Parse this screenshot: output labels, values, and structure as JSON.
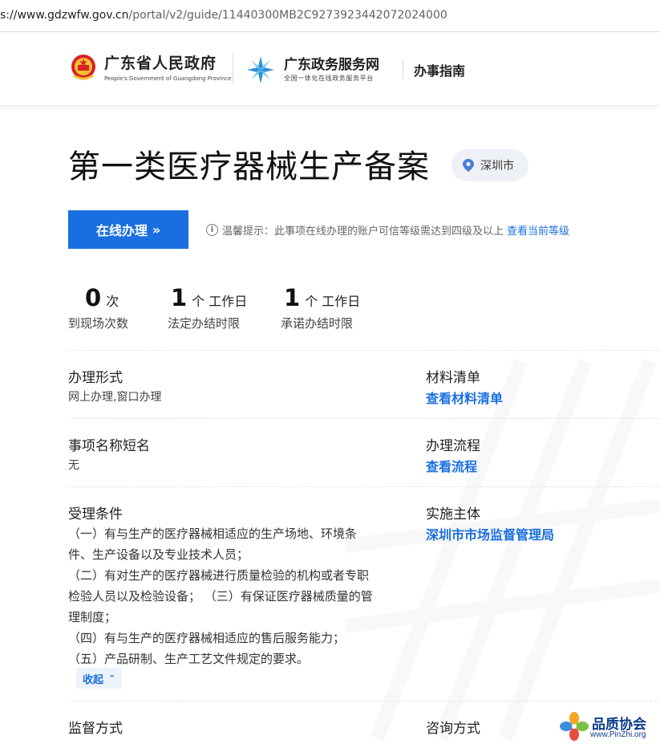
{
  "browser": {
    "url_prefix": "s://www.gdzwfw.gov.cn",
    "url_path": "/portal/v2/guide/11440300MB2C9273923442072024000"
  },
  "header": {
    "gov_name_cn": "广东省人民政府",
    "gov_name_en": "People's Government of Guangdong Province",
    "service_name_cn": "广东政务服务网",
    "service_subtitle": "全国一体化在线政务服务平台",
    "section_label": "办事指南"
  },
  "page": {
    "title": "第一类医疗器械生产备案",
    "region": "深圳市",
    "apply_button": "在线办理",
    "apply_arrow": "»",
    "tip_icon": "i",
    "tip_text": "温馨提示：此事项在线办理的账户可信等级需达到四级及以上",
    "tip_link": "查看当前等级"
  },
  "stats": [
    {
      "value": "0",
      "unit": "次",
      "label": "到现场次数"
    },
    {
      "value": "1",
      "unit": "个 工作日",
      "label": "法定办结时限"
    },
    {
      "value": "1",
      "unit": "个 工作日",
      "label": "承诺办结时限"
    }
  ],
  "fields": {
    "form": {
      "label": "办理形式",
      "value": "网上办理,窗口办理"
    },
    "materials": {
      "label": "材料清单",
      "link": "查看材料清单"
    },
    "short_name": {
      "label": "事项名称短名",
      "value": "无"
    },
    "process": {
      "label": "办理流程",
      "link": "查看流程"
    },
    "conditions": {
      "label": "受理条件",
      "lines": [
        "（一）有与生产的医疗器械相适应的生产场地、环境条",
        "件、生产设备以及专业技术人员；",
        "（二）有对生产的医疗器械进行质量检验的机构或者专职",
        "检验人员以及检验设备；  （三）有保证医疗器械质量的管",
        "理制度；",
        "（四）有与生产的医疗器械相适应的售后服务能力；",
        "（五）产品研制、生产工艺文件规定的要求。"
      ],
      "collapse_label": "收起"
    },
    "authority": {
      "label": "实施主体",
      "link": "深圳市市场监督管理局"
    },
    "supervision": {
      "label": "监督方式"
    },
    "consult": {
      "label": "咨询方式"
    }
  },
  "watermark": {
    "name": "品质协会",
    "url": "www.PinZhi.org"
  },
  "colors": {
    "primary": "#1a6fe0",
    "region_bg": "#eef1f5",
    "text": "#222222"
  }
}
